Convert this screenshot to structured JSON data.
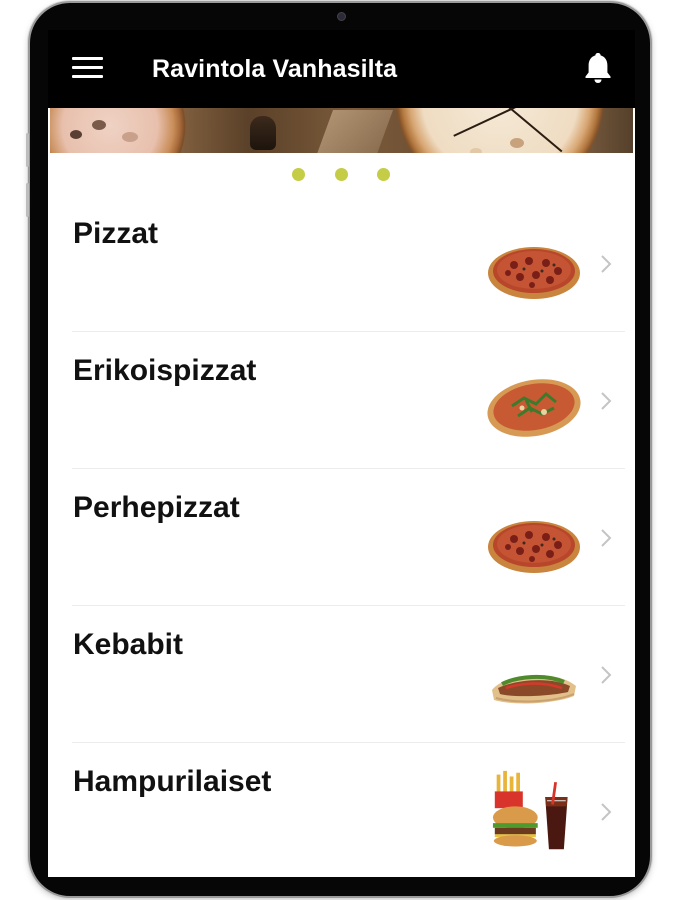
{
  "app": {
    "title": "Ravintola Vanhasilta"
  },
  "toolbar": {
    "menu_icon": "hamburger-menu-icon",
    "notification_icon": "bell-icon"
  },
  "carousel": {
    "slide_count": 3,
    "indicator_color": "#c5cc46"
  },
  "categories": [
    {
      "label": "Pizzat",
      "image": "pepperoni-pizza"
    },
    {
      "label": "Erikoispizzat",
      "image": "arugula-pizza"
    },
    {
      "label": "Perhepizzat",
      "image": "pepperoni-pizza"
    },
    {
      "label": "Kebabit",
      "image": "kebab-wrap"
    },
    {
      "label": "Hampurilaiset",
      "image": "burger-fries-cola"
    }
  ],
  "colors": {
    "toolbar_bg": "#000000",
    "accent": "#c5cc46",
    "text": "#111111"
  }
}
